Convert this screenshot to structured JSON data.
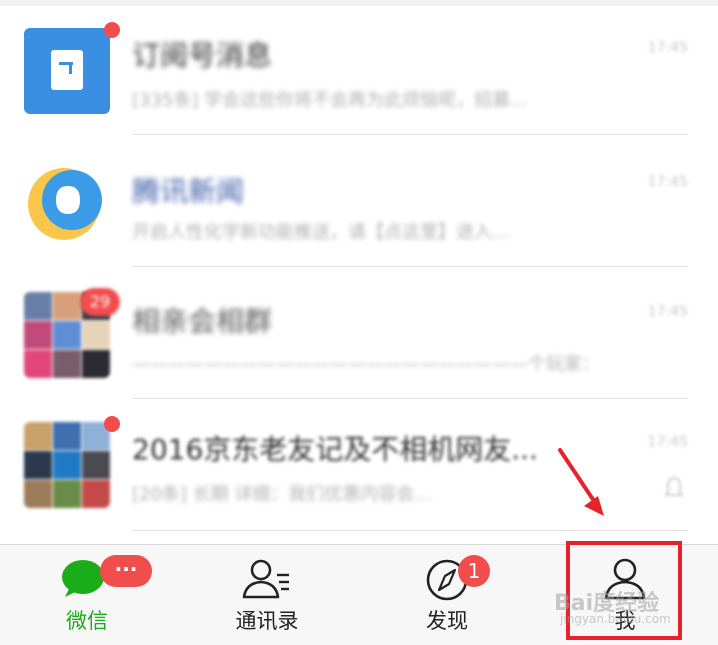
{
  "chats": [
    {
      "title": "订阅号消息",
      "preview": "[335条] 学会这些你将不会再为此烦恼呢，招募...",
      "time": "17:45"
    },
    {
      "title": "腾讯新闻",
      "preview": "开启人性化学新功能推送，请【点这里】进入...",
      "time": "17:45"
    },
    {
      "title": "相亲会相群",
      "preview": "——————————————————————个玩家：",
      "time": "17:45",
      "badge": "29"
    },
    {
      "title": "2016京东老友记及不相机网友...",
      "preview": "[20条] 长期 详细：我们优惠内容会...",
      "time": "17:45"
    }
  ],
  "tabbar": {
    "tabs": [
      {
        "label": "微信",
        "icon": "chat-bubble-icon",
        "badge": "···",
        "active": true
      },
      {
        "label": "通讯录",
        "icon": "contacts-icon"
      },
      {
        "label": "发现",
        "icon": "compass-icon",
        "badge": "1"
      },
      {
        "label": "我",
        "icon": "person-icon"
      }
    ]
  },
  "watermark": {
    "text": "Bai度经验",
    "sub": "jingyan.baidu.com"
  },
  "colors": {
    "active": "#1aad19",
    "badge": "#f24d4d",
    "highlight": "#e8222a"
  }
}
